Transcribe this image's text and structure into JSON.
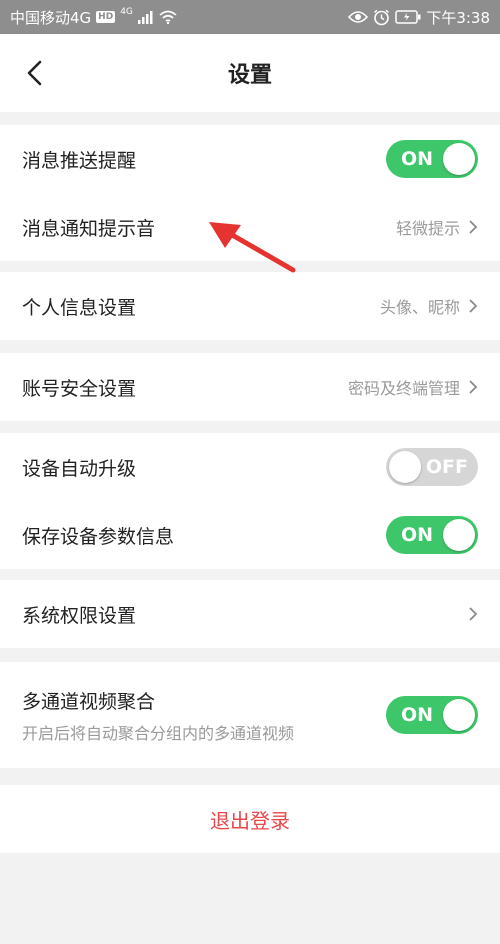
{
  "status_bar": {
    "carrier": "中国移动4G",
    "hd_badge": "HD",
    "net_sup": "4G",
    "time": "下午3:38",
    "icons": [
      "signal-icon",
      "wifi-icon",
      "eye-icon",
      "alarm-icon",
      "battery-icon"
    ]
  },
  "navbar": {
    "title": "设置",
    "back_icon": "chevron-left-icon"
  },
  "groups": {
    "notifications": {
      "push_label": "消息推送提醒",
      "push_toggle": "ON",
      "push_on": true,
      "sound_label": "消息通知提示音",
      "sound_value": "轻微提示"
    },
    "profile": {
      "label": "个人信息设置",
      "value": "头像、昵称"
    },
    "security": {
      "label": "账号安全设置",
      "value": "密码及终端管理"
    },
    "device": {
      "upgrade_label": "设备自动升级",
      "upgrade_toggle": "OFF",
      "upgrade_on": false,
      "save_label": "保存设备参数信息",
      "save_toggle": "ON",
      "save_on": true
    },
    "permissions": {
      "label": "系统权限设置"
    },
    "video": {
      "label": "多通道视频聚合",
      "sub": "开启后将自动聚合分组内的多通道视频",
      "toggle": "ON",
      "on": true
    }
  },
  "logout": {
    "label": "退出登录"
  },
  "colors": {
    "toggle_on": "#3ec76a",
    "toggle_off": "#d6d6d6",
    "logout": "#e8484a",
    "arrow": "#e5342f"
  }
}
